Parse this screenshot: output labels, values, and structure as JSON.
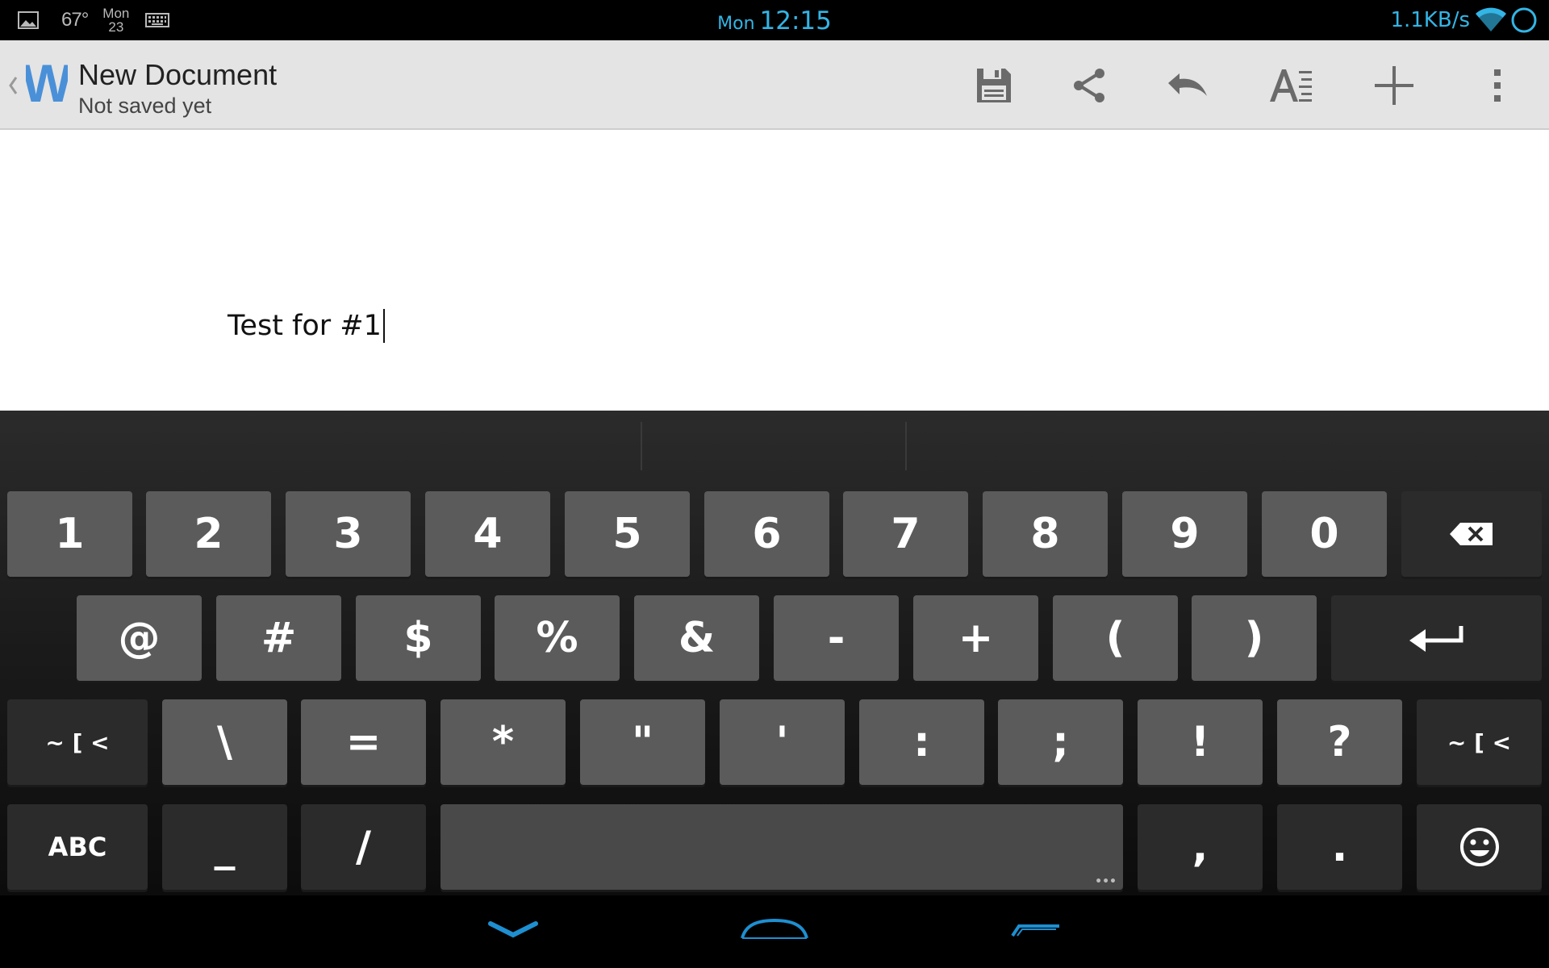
{
  "status_bar": {
    "temperature": "67°",
    "date_day": "Mon",
    "date_num": "23",
    "clock_day": "Mon",
    "clock_time": "12:15",
    "network_speed": "1.1KB/s",
    "icons": [
      "gallery-icon",
      "keyboard-icon",
      "wifi-icon",
      "battery-icon"
    ],
    "accent_color": "#33b5e5"
  },
  "action_bar": {
    "app_logo": "W",
    "title": "New Document",
    "subtitle": "Not saved yet",
    "actions": [
      "save-icon",
      "share-icon",
      "undo-icon",
      "text-format-icon",
      "add-icon",
      "overflow-menu-icon"
    ]
  },
  "document": {
    "text": "Test for #1"
  },
  "keyboard": {
    "row1": [
      "1",
      "2",
      "3",
      "4",
      "5",
      "6",
      "7",
      "8",
      "9",
      "0"
    ],
    "row2": [
      "@",
      "#",
      "$",
      "%",
      "&",
      "-",
      "+",
      "(",
      ")"
    ],
    "row3": [
      "\\",
      "=",
      "*",
      "\"",
      "'",
      ":",
      ";",
      "!",
      "?"
    ],
    "more_symbols_label": "~ [ <",
    "abc_label": "ABC",
    "row4": [
      "_",
      "/",
      ",",
      "."
    ],
    "icons": [
      "backspace-icon",
      "enter-icon",
      "emoji-icon"
    ]
  },
  "nav_bar": {
    "icons": [
      "back-icon",
      "home-icon",
      "recent-apps-icon"
    ]
  }
}
